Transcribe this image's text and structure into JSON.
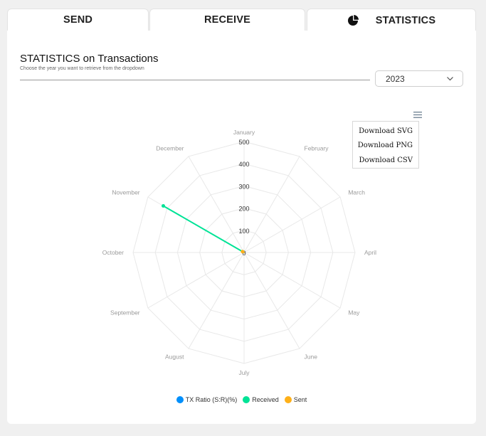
{
  "tabs": [
    {
      "label": "SEND",
      "active": false
    },
    {
      "label": "RECEIVE",
      "active": false
    },
    {
      "label": "STATISTICS",
      "active": true,
      "icon": "pie-chart-icon"
    }
  ],
  "header": {
    "title": "STATISTICS on Transactions",
    "subtitle": "Choose the year you want to retrieve from the dropdown"
  },
  "year_select": {
    "value": "2023"
  },
  "toolbar_menu": {
    "icon": "hamburger-menu-icon",
    "items": [
      "Download SVG",
      "Download PNG",
      "Download CSV"
    ]
  },
  "chart_data": {
    "type": "radar",
    "categories": [
      "January",
      "February",
      "March",
      "April",
      "May",
      "June",
      "July",
      "August",
      "September",
      "October",
      "November",
      "December"
    ],
    "radial_ticks": [
      "0",
      "100",
      "200",
      "300",
      "400",
      "500"
    ],
    "rlim": [
      0,
      500
    ],
    "series": [
      {
        "name": "TX Ratio (S:R)(%)",
        "color": "#008FFB",
        "values": [
          0,
          0,
          0,
          0,
          0,
          0,
          0,
          0,
          0,
          0,
          0,
          0
        ]
      },
      {
        "name": "Received",
        "color": "#00E396",
        "values": [
          0,
          0,
          0,
          0,
          0,
          0,
          0,
          0,
          0,
          0,
          420,
          0
        ]
      },
      {
        "name": "Sent",
        "color": "#FEB019",
        "values": [
          0,
          0,
          0,
          0,
          0,
          0,
          0,
          0,
          0,
          0,
          8,
          0
        ]
      }
    ],
    "legend_position": "bottom"
  }
}
